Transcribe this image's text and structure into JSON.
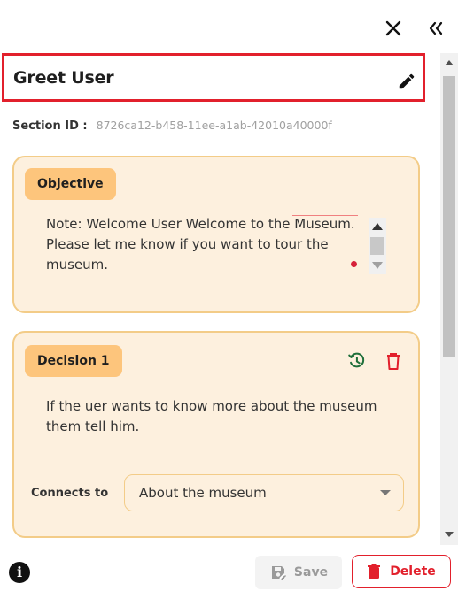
{
  "panel": {
    "title": "Greet User",
    "section_id_label": "Section ID :",
    "section_id_value": "8726ca12-b458-11ee-a1ab-42010a40000f"
  },
  "objective": {
    "label": "Objective",
    "text": "Note: Welcome User Welcome to the Museum. Please let me know if you want to tour the museum."
  },
  "decision": {
    "label": "Decision 1",
    "text": "If the uer wants to know more about the museum them tell him.",
    "connects_label": "Connects to",
    "connects_value": "About the museum"
  },
  "footer": {
    "save_label": "Save",
    "delete_label": "Delete"
  },
  "icons": {
    "close": "close-icon",
    "collapse": "double-chevron-left-icon",
    "edit": "pencil-icon",
    "history": "history-icon",
    "trash": "trash-icon",
    "info": "info-icon",
    "save": "save-icon"
  },
  "colors": {
    "accent_red": "#e2202c",
    "card_bg": "#fdf0de",
    "card_border": "#f3cc88",
    "pill_bg": "#fdc57c",
    "history_green": "#1f6f3a"
  }
}
